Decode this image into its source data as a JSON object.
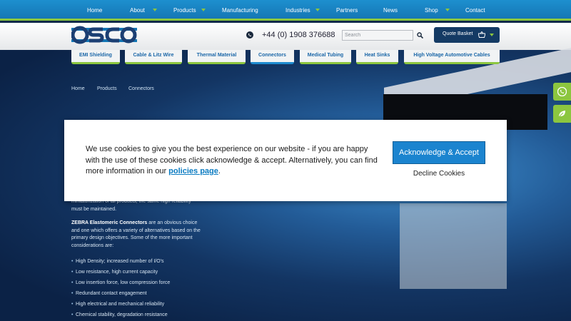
{
  "topnav": {
    "items": [
      "Home",
      "About",
      "Products",
      "Manufacturing",
      "Industries",
      "Partners",
      "News",
      "Shop",
      "Contact"
    ]
  },
  "header": {
    "phone": "+44 (0) 1908 376688",
    "search_placeholder": "Search",
    "basket_label": "Quote Basket"
  },
  "categories": [
    "EMI Shielding",
    "Cable & Litz Wire",
    "Thermal Material",
    "Connectors",
    "Medical Tubing",
    "Heat Sinks",
    "High Voltage Automotive Cables"
  ],
  "breadcrumb": [
    "Home",
    "Products",
    "Connectors"
  ],
  "content": {
    "partial_line1": "miniaturization of all products, the same high reliability",
    "partial_line2": "must be maintained.",
    "zebra_bold": "ZEBRA Elastomeric Connectors",
    "zebra_line1": "are an obvious choice",
    "zebra_line2": "and one which offers a variety of alternatives based on the",
    "zebra_line3": "primary design objectives. Some of the more important",
    "zebra_line4": "considerations are:",
    "bullets": [
      "High Density; increased number of I/O's",
      "Low resistance, high current capacity",
      "Low insertion force, low compression force",
      "Redundant contact engagement",
      "High electrical and mechanical reliability",
      "Chemical stability, degradation resistance"
    ]
  },
  "cookie": {
    "message": "We use cookies to give you the best experience on our website - if you are happy with the use of these cookies click acknowledge & accept. Alternatively, you can find more information in our ",
    "link": "policies page",
    "period": ".",
    "accept_label": "Acknowledge & Accept",
    "decline_label": "Decline Cookies"
  },
  "colors": {
    "nav_blue": "#1577b5",
    "accent_green": "#8cc63f",
    "button_blue": "#1b84cf",
    "basket_navy": "#143a64"
  },
  "icons": [
    "osco-logo",
    "phone-icon",
    "search-icon",
    "basket-icon",
    "chevron-down-icon",
    "phone-widget-icon",
    "leaf-widget-icon"
  ]
}
